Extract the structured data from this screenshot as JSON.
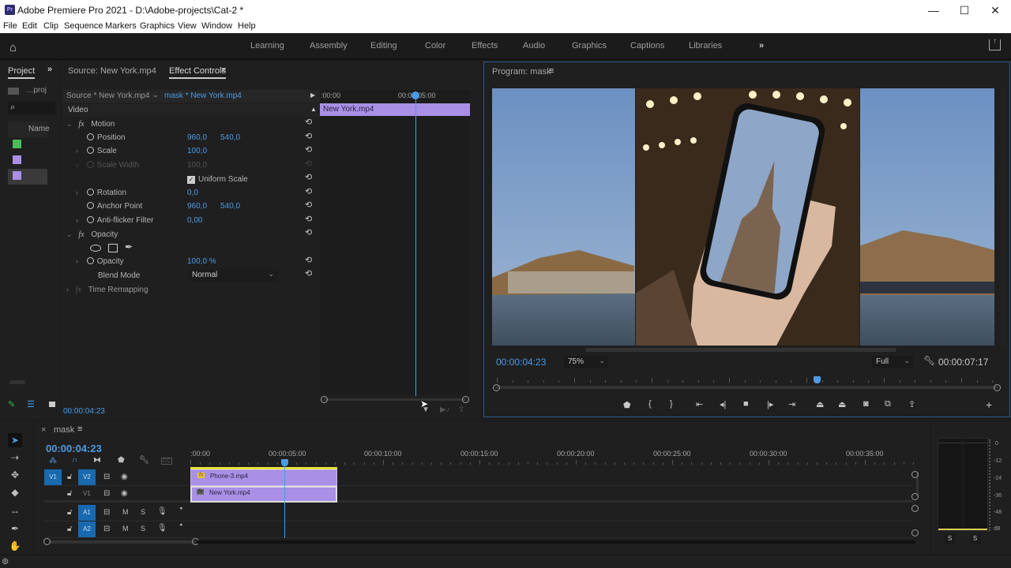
{
  "window": {
    "title": "Adobe Premiere Pro 2021 - D:\\Adobe-projects\\Cat-2 *",
    "app_icon": "Pr",
    "controls": {
      "minimize": "—",
      "maximize": "☐",
      "close": "✕"
    }
  },
  "menubar": [
    "File",
    "Edit",
    "Clip",
    "Sequence",
    "Markers",
    "Graphics",
    "View",
    "Window",
    "Help"
  ],
  "workspaces": {
    "items": [
      "Learning",
      "Assembly",
      "Editing",
      "Color",
      "Effects",
      "Audio",
      "Graphics",
      "Captions",
      "Libraries"
    ],
    "more": "»"
  },
  "project_panel": {
    "tab": "Project",
    "more": "»",
    "folder_label": "...proj",
    "column_header": "Name",
    "items": [
      {
        "color": "#4cbb5a"
      },
      {
        "color": "#a98fe6"
      },
      {
        "color": "#a98fe6"
      }
    ]
  },
  "effect_controls": {
    "tabs": {
      "source": "Source: New York.mp4",
      "active": "Effect Controls",
      "menu": "≡"
    },
    "source_clip": "Source * New York.mp4",
    "sequence_clip": "mask * New York.mp4",
    "section_video": "Video",
    "motion": {
      "label": "Motion",
      "position": {
        "label": "Position",
        "x": "960,0",
        "y": "540,0"
      },
      "scale": {
        "label": "Scale",
        "value": "100,0"
      },
      "scale_width": {
        "label": "Scale Width",
        "value": "100,0"
      },
      "uniform_scale": {
        "label": "Uniform Scale",
        "checked": true
      },
      "rotation": {
        "label": "Rotation",
        "value": "0,0"
      },
      "anchor_point": {
        "label": "Anchor Point",
        "x": "960,0",
        "y": "540,0"
      },
      "anti_flicker": {
        "label": "Anti-flicker Filter",
        "value": "0,00"
      }
    },
    "opacity": {
      "label": "Opacity",
      "opacity_value": {
        "label": "Opacity",
        "value": "100,0 %"
      },
      "blend_mode": {
        "label": "Blend Mode",
        "value": "Normal"
      }
    },
    "time_remapping": {
      "label": "Time Remapping"
    },
    "mini_timeline": {
      "ruler_start": ":00:00",
      "ruler_mark": "00:00:05:00",
      "clip_label": "New York.mp4",
      "clip_color": "#a98fe6"
    },
    "timecode": "00:00:04:23"
  },
  "program_monitor": {
    "title": "Program: mask",
    "menu": "≡",
    "current_time": "00:00:04:23",
    "zoom": "75%",
    "resolution": "Full",
    "duration": "00:00:07:17",
    "playhead_fraction": 0.64
  },
  "timeline": {
    "sequence_name": "mask",
    "close": "×",
    "menu": "≡",
    "timecode": "00:00:04:23",
    "ruler_labels": [
      ":00:00",
      "00:00:05:00",
      "00:00:10:00",
      "00:00:15:00",
      "00:00:20:00",
      "00:00:25:00",
      "00:00:30:00",
      "00:00:35:00"
    ],
    "tracks": {
      "video": [
        {
          "source": "V1",
          "name": "V2"
        },
        {
          "source": "",
          "name": "V1"
        }
      ],
      "audio": [
        {
          "name": "A1",
          "mute": "M",
          "solo": "S"
        },
        {
          "name": "A2",
          "mute": "M",
          "solo": "S"
        }
      ]
    },
    "clips": [
      {
        "label": "Phone-3.mp4",
        "track": "V2",
        "fx": "fx"
      },
      {
        "label": "New York.mp4",
        "track": "V1",
        "fx": "fx"
      }
    ],
    "clip_color": "#a98fe6"
  },
  "audio_meter": {
    "scale": [
      "0",
      "-12",
      "-24",
      "-36",
      "-48",
      "dB"
    ],
    "solo_buttons": [
      "S",
      "S"
    ]
  }
}
